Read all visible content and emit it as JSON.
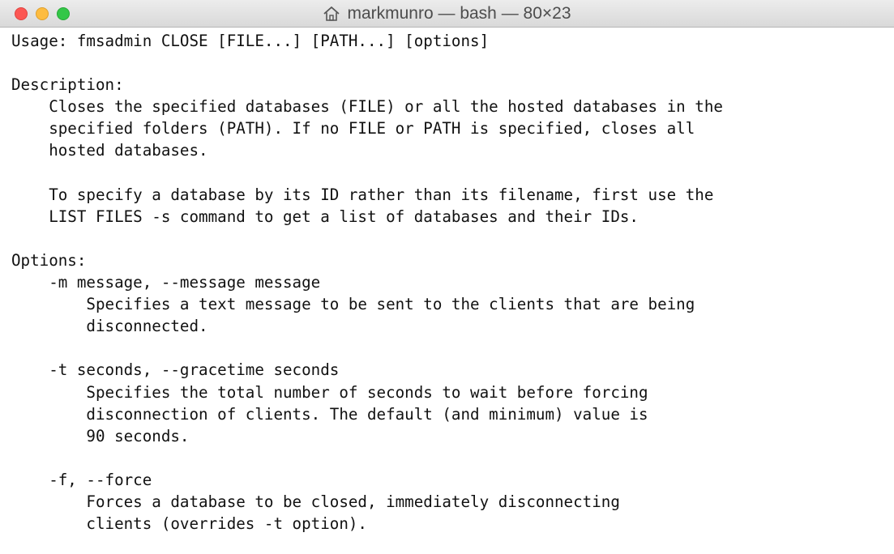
{
  "window": {
    "title": "markmunro — bash — 80×23",
    "home_icon": "home-icon",
    "buttons": {
      "close_color": "#fc5753",
      "minimize_color": "#fdbc40",
      "zoom_color": "#33c748"
    }
  },
  "terminal": {
    "lines": [
      "Usage: fmsadmin CLOSE [FILE...] [PATH...] [options]",
      "",
      "Description:",
      "    Closes the specified databases (FILE) or all the hosted databases in the",
      "    specified folders (PATH). If no FILE or PATH is specified, closes all",
      "    hosted databases.",
      "",
      "    To specify a database by its ID rather than its filename, first use the",
      "    LIST FILES -s command to get a list of databases and their IDs.",
      "",
      "Options:",
      "    -m message, --message message",
      "        Specifies a text message to be sent to the clients that are being",
      "        disconnected.",
      "",
      "    -t seconds, --gracetime seconds",
      "        Specifies the total number of seconds to wait before forcing",
      "        disconnection of clients. The default (and minimum) value is",
      "        90 seconds.",
      "",
      "    -f, --force",
      "        Forces a database to be closed, immediately disconnecting",
      "        clients (overrides -t option)."
    ]
  }
}
